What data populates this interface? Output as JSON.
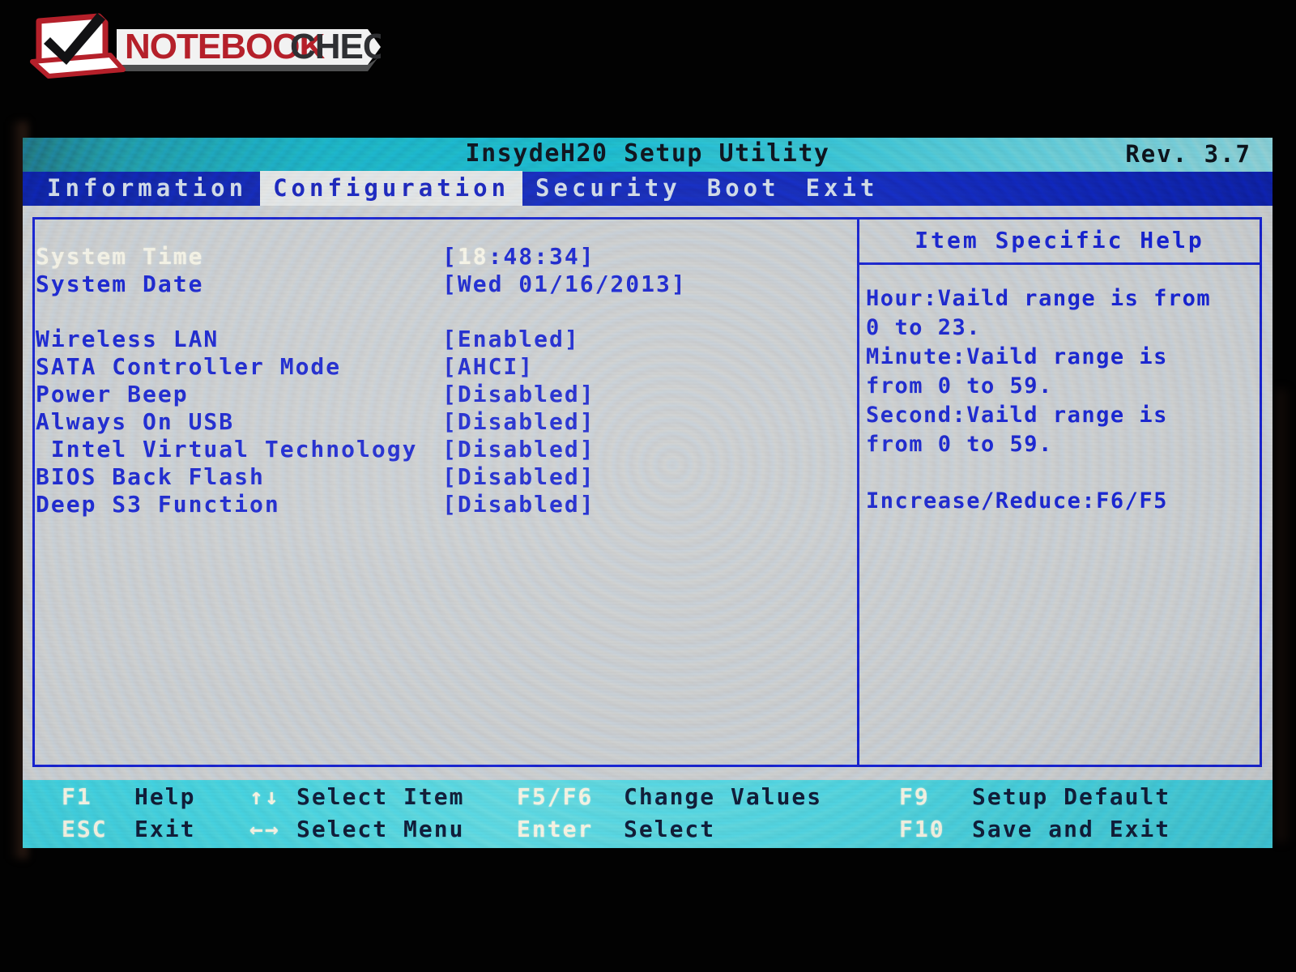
{
  "watermark": {
    "brand_bold": "NOTEBOOK",
    "brand_light": "CHECK",
    "icon": "laptop-checkmark-logo"
  },
  "screen": {
    "title": "InsydeH20 Setup Utility",
    "revision": "Rev. 3.7",
    "menu_tabs": [
      {
        "label": "Information",
        "selected": false
      },
      {
        "label": "Configuration",
        "selected": true
      },
      {
        "label": "Security",
        "selected": false
      },
      {
        "label": "Boot",
        "selected": false
      },
      {
        "label": "Exit",
        "selected": false
      }
    ],
    "settings": [
      {
        "label": "System Time",
        "value_prefix": "[",
        "value_hl": "18",
        "value_suffix": ":48:34]",
        "active": true
      },
      {
        "label": "System Date",
        "value": "[Wed 01/16/2013]",
        "active": false
      },
      {
        "spacer": true
      },
      {
        "label": "Wireless LAN",
        "value": "[Enabled]",
        "active": false
      },
      {
        "label": "SATA Controller Mode",
        "value": "[AHCI]",
        "active": false
      },
      {
        "label": "Power Beep",
        "value": "[Disabled]",
        "active": false
      },
      {
        "label": "Always On USB",
        "value": "[Disabled]",
        "active": false
      },
      {
        "label": " Intel Virtual Technology",
        "value": "[Disabled]",
        "active": false
      },
      {
        "label": "BIOS Back Flash",
        "value": "[Disabled]",
        "active": false
      },
      {
        "label": "Deep S3 Function",
        "value": "[Disabled]",
        "active": false
      }
    ],
    "help": {
      "title": "Item Specific Help",
      "lines": [
        "Hour:Vaild range is from",
        "0 to 23.",
        "Minute:Vaild range is",
        "from 0 to 59.",
        "Second:Vaild range is",
        "from 0 to 59."
      ],
      "footer_line": "Increase/Reduce:F6/F5"
    },
    "footer": {
      "row1": [
        {
          "key": "F1",
          "desc": "Help"
        },
        {
          "key": "↑↓",
          "desc": "Select Item"
        },
        {
          "key": "F5/F6",
          "desc": "Change Values"
        },
        {
          "key": "F9",
          "desc": "Setup Default"
        }
      ],
      "row2": [
        {
          "key": "ESC",
          "desc": "Exit"
        },
        {
          "key": "←→",
          "desc": "Select Menu"
        },
        {
          "key": "Enter",
          "desc": "Select"
        },
        {
          "key": "F10",
          "desc": "Save and Exit"
        }
      ]
    }
  },
  "colors": {
    "title_bar_cyan": "#16b2c6",
    "menu_bar_blue": "#1126b4",
    "panel_bg": "#c6c8ca",
    "text_blue": "#1620c8",
    "highlight_cream": "#f3f1df",
    "footer_cyan": "#46cdd8",
    "brand_red": "#b5202a",
    "brand_dark": "#2f3033"
  }
}
